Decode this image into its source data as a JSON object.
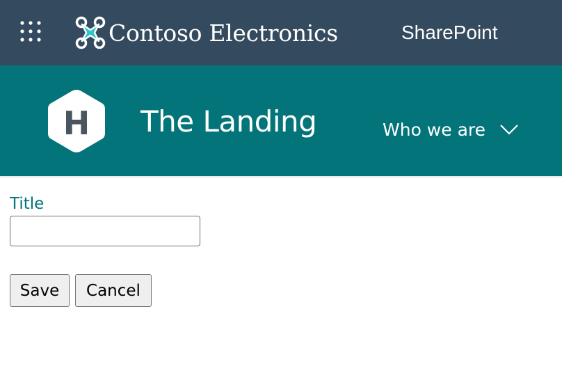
{
  "suite_bar": {
    "brand_name": "Contoso Electronics",
    "app_name": "SharePoint",
    "icons": {
      "app_launcher": "waffle-icon",
      "brand_logo": "drone-logo"
    },
    "colors": {
      "background": "#344a5e",
      "logo_accent": "#2cc5c9"
    }
  },
  "site_header": {
    "logo_letter": "H",
    "title": "The Landing",
    "nav": [
      {
        "label": "Who we are",
        "icon": "chevron-down-icon"
      }
    ],
    "colors": {
      "background": "#037479",
      "logo_text": "#4a5560"
    }
  },
  "form": {
    "title_label": "Title",
    "title_value": "",
    "save_label": "Save",
    "cancel_label": "Cancel",
    "colors": {
      "label": "#037479"
    }
  }
}
